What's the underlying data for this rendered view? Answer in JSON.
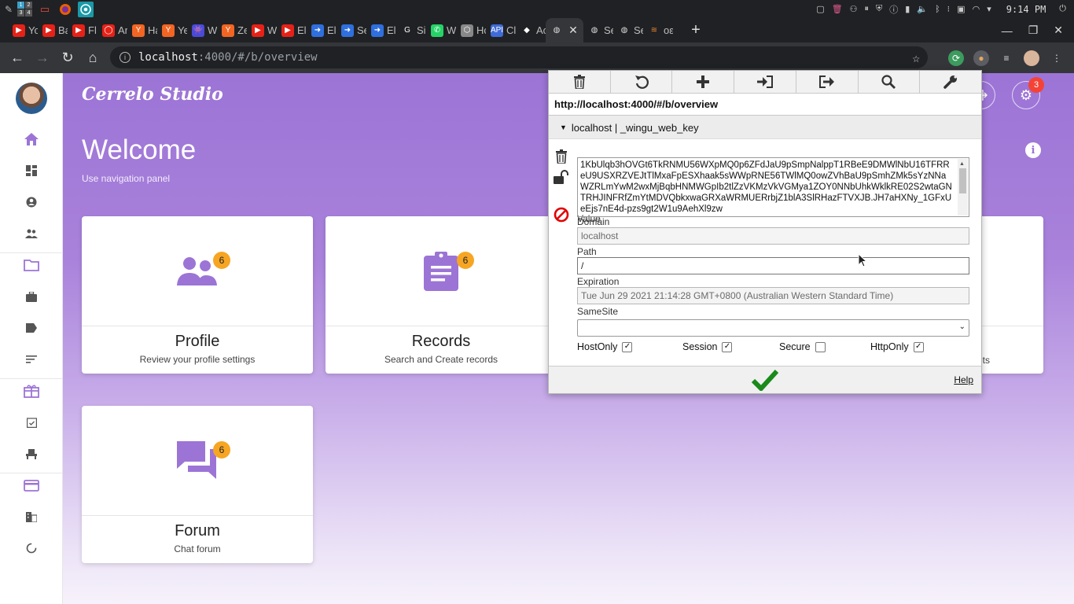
{
  "taskbar": {
    "workspaces": [
      "1",
      "2",
      "3",
      "4"
    ],
    "clock": "9:14 PM"
  },
  "tabs": [
    {
      "label": "Yo",
      "color": "#e62117",
      "glyph": "▶"
    },
    {
      "label": "Ba",
      "color": "#e62117",
      "glyph": "▶"
    },
    {
      "label": "Fl",
      "color": "#e62117",
      "glyph": "▶"
    },
    {
      "label": "Ar",
      "color": "#e62117",
      "glyph": "◯"
    },
    {
      "label": "Ha",
      "color": "#f26522",
      "glyph": "Y"
    },
    {
      "label": "Ye",
      "color": "#f26522",
      "glyph": "Y"
    },
    {
      "label": "Wi",
      "color": "#4a4ad8",
      "glyph": "👾"
    },
    {
      "label": "Ze",
      "color": "#f26522",
      "glyph": "Y"
    },
    {
      "label": "We",
      "color": "#e62117",
      "glyph": "▶"
    },
    {
      "label": "El",
      "color": "#e62117",
      "glyph": "▶"
    },
    {
      "label": "El",
      "color": "#2f6fde",
      "glyph": "➜"
    },
    {
      "label": "Se",
      "color": "#2f6fde",
      "glyph": "➜"
    },
    {
      "label": "El",
      "color": "#2f6fde",
      "glyph": "➜"
    },
    {
      "label": "Si",
      "color": "#ffffff",
      "glyph": "G"
    },
    {
      "label": "Wh",
      "color": "#25d366",
      "glyph": "✆"
    },
    {
      "label": "Hc",
      "color": "#888888",
      "glyph": "⬡"
    },
    {
      "label": "Cl",
      "color": "#3f6bd8",
      "glyph": "API"
    },
    {
      "label": "Ac",
      "color": "#ffffff",
      "glyph": "◆"
    },
    {
      "label": "Se",
      "color": "#dddddd",
      "glyph": "◍"
    },
    {
      "label": "Se",
      "color": "#dddddd",
      "glyph": "◍"
    }
  ],
  "active_tab": {
    "glyph": "◍",
    "close": "✕"
  },
  "last_tab": {
    "label": "oε",
    "glyph": "≋"
  },
  "window_controls": {
    "minimize": "—",
    "restore": "❐",
    "close": "✕"
  },
  "address_bar": {
    "host": "localhost",
    "rest": ":4000/#/b/overview"
  },
  "app": {
    "brand": "Cerrelo Studio",
    "title": "Welcome",
    "subtitle": "Use navigation panel",
    "settings_badge": "3",
    "cards": [
      {
        "title": "Profile",
        "desc": "Review your profile settings",
        "badge": "6",
        "icon": "profile"
      },
      {
        "title": "Records",
        "desc": "Search and Create records",
        "badge": "6",
        "icon": "records"
      },
      {
        "title": "Forum",
        "desc": "Chat forum",
        "badge": "6",
        "icon": "forum"
      }
    ],
    "hidden_card_desc_tail": "ts"
  },
  "cookie_editor": {
    "url": "http://localhost:4000/#/b/overview",
    "cookie_header": "localhost | _wingu_web_key",
    "value_label": "Value",
    "value": "1KbUlqb3hOVGt6TkRNMU56WXpMQ0p6ZFdJaU9pSmpNalppT1RBeE9DMWlNbU16TFRReU9USXRZVEJtTlMxaFpESXhaak5sWWpRNE56TWlMQ0owZVhBaU9pSmhZMk5sYzNNaWZRLmYwM2wxMjBqbHNMWGpIb2tlZzVKMzVkVGMya1ZOY0NNbUhkWklkRE02S2wtaGNTRHJINFRfZmYtMDVQbkxwaGRXaWRMUERrbjZ1blA3SlRHazFTVXJB.JH7aHXNy_1GFxUeEjs7nE4d-pzs9gt2W1u9AehXl9zw",
    "domain_label": "Domain",
    "domain": "localhost",
    "path_label": "Path",
    "path": "/",
    "expiration_label": "Expiration",
    "expiration": "Tue Jun 29 2021 21:14:28 GMT+0800 (Australian Western Standard Time)",
    "samesite_label": "SameSite",
    "samesite": "",
    "flags": [
      {
        "label": "HostOnly",
        "checked": true
      },
      {
        "label": "Session",
        "checked": true
      },
      {
        "label": "Secure",
        "checked": false
      },
      {
        "label": "HttpOnly",
        "checked": true
      }
    ],
    "help": "Help"
  },
  "colors": {
    "accent": "#9c74d6",
    "badge_orange": "#f6a623",
    "badge_red": "#f44336",
    "confirm_green": "#1a8a1a"
  }
}
